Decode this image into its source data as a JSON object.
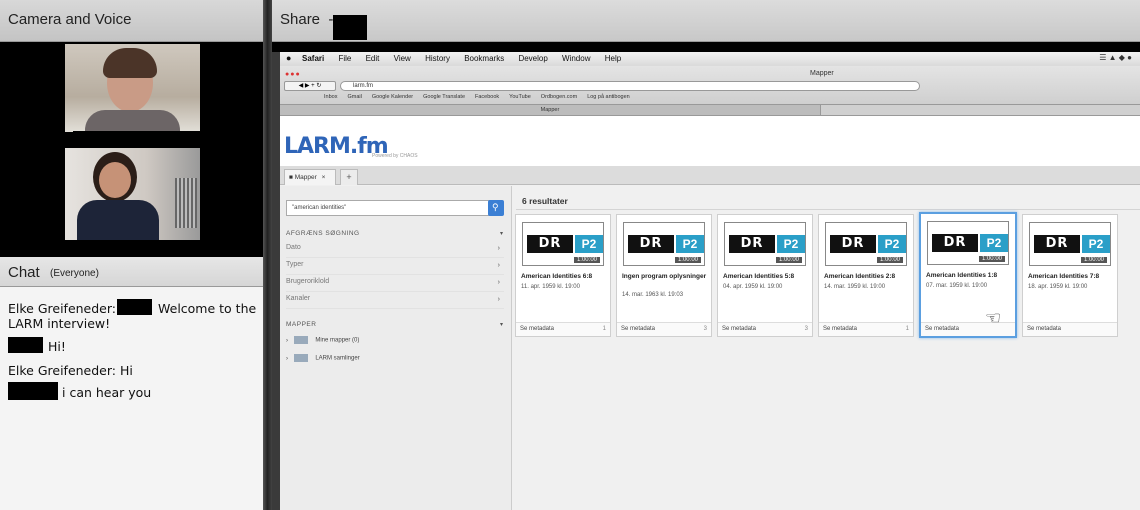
{
  "left_panel": {
    "camera_title": "Camera and Voice",
    "chat_title": "Chat",
    "chat_scope": "(Everyone)",
    "messages": [
      {
        "text": "Elke Greifeneder: Hi",
        "text2": "Welcome to the"
      },
      {
        "text": "LARM interview!"
      },
      {
        "text": "Hi!"
      },
      {
        "text": "Elke Greifeneder: Hi"
      },
      {
        "text": "i can hear you"
      }
    ]
  },
  "share": {
    "title": "Share  -",
    "mac_menu": [
      "Safari",
      "File",
      "Edit",
      "View",
      "History",
      "Bookmarks",
      "Develop",
      "Window",
      "Help"
    ],
    "window_title": "Mapper",
    "url": "larm.fm",
    "bookmarks": [
      "Inbox",
      "Gmail",
      "Google Kalender",
      "Google Translate",
      "Facebook",
      "YouTube",
      "Ordbogen.com",
      "Log på antibogen"
    ],
    "tab_title": "Mapper"
  },
  "app": {
    "logo": "LARM.fm",
    "powered": "Powered by CHAOS",
    "tab_label": "Mapper",
    "tab_close": "×",
    "tab_add": "+",
    "search_value": "\"american identities\"",
    "refine_heading": "AFGRÆNS SØGNING",
    "facets": [
      "Dato",
      "Typer",
      "Brugeroriklold",
      "Kanaler"
    ],
    "folders_heading": "MAPPER",
    "folders": [
      "Mine mapper (0)",
      "LARM samlinger"
    ],
    "results_count": "6 resultater",
    "results": [
      {
        "title": "American Identities 6:8",
        "date": "11. apr. 1959 kl. 19:00",
        "meta": "Se metadata",
        "count": "1",
        "dr": "DR",
        "p2": "P2",
        "duration": "1:00:00"
      },
      {
        "title": "Ingen program oplysninger",
        "date": "14. mar. 1963 kl. 19:03",
        "meta": "Se metadata",
        "count": "3",
        "dr": "DR",
        "p2": "P2",
        "duration": "1:00:00"
      },
      {
        "title": "American Identities 5:8",
        "date": "04. apr. 1959 kl. 19:00",
        "meta": "Se metadata",
        "count": "3",
        "dr": "DR",
        "p2": "P2",
        "duration": "1:00:00"
      },
      {
        "title": "American Identities 2:8",
        "date": "14. mar. 1959 kl. 19:00",
        "meta": "Se metadata",
        "count": "1",
        "dr": "DR",
        "p2": "P2",
        "duration": "1:00:00"
      },
      {
        "title": "American Identities 1:8",
        "date": "07. mar. 1959 kl. 19:00",
        "meta": "Se metadata",
        "count": "",
        "dr": "DR",
        "p2": "P2",
        "duration": "1:00:00"
      },
      {
        "title": "American Identities 7:8",
        "date": "18. apr. 1959 kl. 19:00",
        "meta": "Se metadata",
        "count": "",
        "dr": "DR",
        "p2": "P2",
        "duration": "1:00:00"
      }
    ]
  },
  "colors": {
    "accent": "#3b7fd4",
    "p2_blue": "#2a9fc8",
    "header_grey": "#cfcfcf"
  }
}
